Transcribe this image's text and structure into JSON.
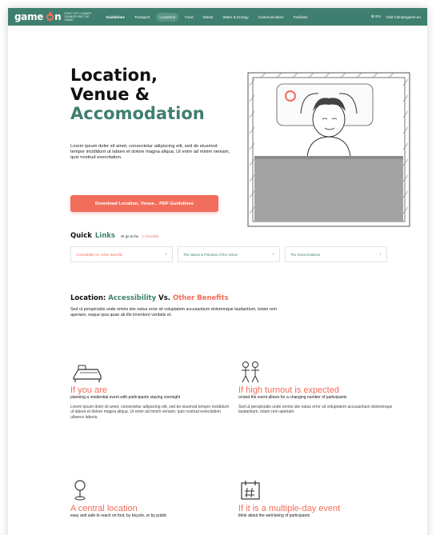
{
  "nav": {
    "logo_text_1": "game",
    "logo_text_2": "n",
    "tagline": "Don't let climate change end the game!",
    "links": [
      "Guidelines",
      "Transport",
      "Locations",
      "Food",
      "Waste",
      "Water & Energy",
      "Communication",
      "Facilities"
    ],
    "lang": "EN",
    "visit": "Visit Climategame.eu"
  },
  "hero": {
    "title_line1": "Location,",
    "title_line2": "Venue &",
    "title_line3": "Accomodation",
    "body": "Lorem ipsum dolor sit amet, consectetur adipiscing elit, sed do eiusmod tempor incididunt ut labore et dolore magna aliqua. Ut enim ad minim veniam, quis nostrud exercitation.",
    "download_button": "Download Location, Venue... PDF Guidelines"
  },
  "quick_links": {
    "title_part1": "Quick",
    "title_part2": "Links",
    "goto": "Or go to the",
    "checklist": "checklist",
    "items": [
      {
        "label": "Accessibility Vs. Other Benefits",
        "arrow": "↓"
      },
      {
        "label": "The Values & Practices of the Venue",
        "arrow": "↓"
      },
      {
        "label": "The Great Outdoors",
        "arrow": "↓"
      }
    ]
  },
  "section": {
    "title_part1": "Location:",
    "title_part2": "Accessibility",
    "title_part3": "Vs.",
    "title_part4": "Other Benefits",
    "body": "Sed ut perspiciatis unde omnis iste natus error sit voluptatem accusantium doloremque laudantium, totam rem aperiam, eaque ipsa quae ab illo inventore veritatis et."
  },
  "features": [
    {
      "icon": "bed-icon",
      "heading": "If you are",
      "subheading": "planning a residential event with participants staying overnight",
      "body": "Lorem ipsum dolor sit amet, consectetur adipiscing elit, sed do eiusmod tempor incididunt ut labore et dolore magna aliqua. Ut enim ad minim veniam, quis nostrud exercitation ullamco laboris."
    },
    {
      "icon": "people-icon",
      "heading": "If high turnout is expected",
      "subheading": "or/and the event allows for a changing number of participants",
      "body": "Sed ut perspiciatis unde omnis iste natus error sit voluptatem accusantium doloremque laudantium, totam rem aperiam."
    },
    {
      "icon": "location-pin-icon",
      "heading": "A central location",
      "subheading": "easy and safe to reach on foot, by bicycle, or by public",
      "body": ""
    },
    {
      "icon": "calendar-icon",
      "heading": "If it is a multiple-day event",
      "subheading": "think about the well-being of participants",
      "body": ""
    }
  ],
  "colors": {
    "brand_green": "#3f7f6f",
    "accent_coral": "#f26d5b"
  }
}
